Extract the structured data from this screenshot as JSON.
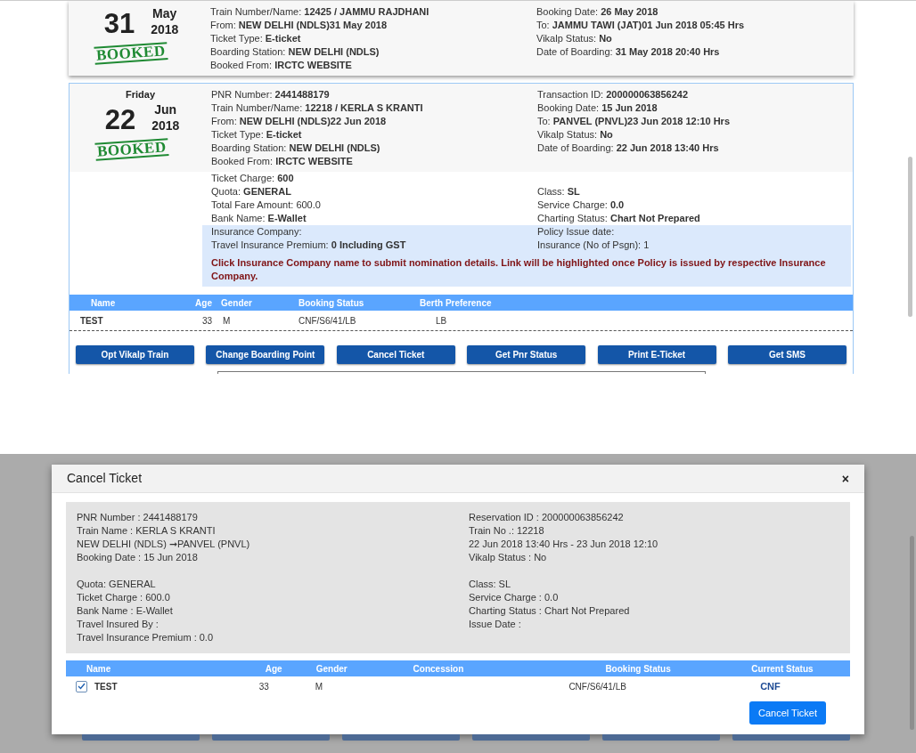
{
  "bookings": [
    {
      "selected": false,
      "day": "31",
      "month": "May",
      "year": "2018",
      "stamp": "BOOKED",
      "left": [
        "Train Number/Name: **12425 / JAMMU RAJDHANI**",
        "From: **NEW DELHI (NDLS)31 May 2018**",
        "Ticket Type: **E-ticket**",
        "Boarding Station: **NEW DELHI (NDLS)**",
        "Booked From: **IRCTC WEBSITE**"
      ],
      "right": [
        "Booking Date: **26 May 2018**",
        "To: **JAMMU TAWI (JAT)01 Jun 2018 05:45 Hrs**",
        "Vikalp Status: **No**",
        "Date of Boarding: **31 May 2018 20:40 Hrs**"
      ]
    },
    {
      "selected": true,
      "weekday": "Friday",
      "day": "22",
      "month": "Jun",
      "year": "2018",
      "stamp": "BOOKED",
      "left": [
        "PNR Number: **2441488179**",
        "Train Number/Name: **12218 / KERLA S KRANTI**",
        "From: **NEW DELHI (NDLS)22 Jun 2018**",
        "Ticket Type: **E-ticket**",
        "Boarding Station: **NEW DELHI (NDLS)**",
        "Booked From: **IRCTC WEBSITE**"
      ],
      "right": [
        "Transaction ID: **200000063856242**",
        "Booking Date: **15 Jun 2018**",
        "To: **PANVEL (PNVL)23 Jun 2018 12:10 Hrs**",
        "Vikalp Status: **No**",
        "Date of Boarding: **22 Jun 2018 13:40 Hrs**"
      ],
      "details": [
        {
          "left": "Ticket Charge: **600**"
        },
        {
          "left": "Quota: **GENERAL**",
          "right": "Class: **SL**"
        },
        {
          "left": "Total Fare Amount: 600.0",
          "right": "Service Charge: **0.0**"
        },
        {
          "left": "Bank Name: **E-Wallet**",
          "right": "Charting Status: **Chart Not Prepared**"
        }
      ],
      "insurance": [
        {
          "left": "Insurance Company:",
          "right": "Policy Issue date:"
        },
        {
          "left": "Travel Insurance Premium: **0 Including GST**",
          "right": "Insurance (No of Psgn): 1"
        }
      ],
      "notice": "Click Insurance Company name to submit nomination details. Link will be highlighted once Policy is issued by respective Insurance Company.",
      "passengers": {
        "columns": [
          "Name",
          "Age",
          "Gender",
          "Booking Status",
          "Berth Preference"
        ],
        "rows": [
          [
            "TEST",
            "33",
            "M",
            "CNF/S6/41/LB",
            "LB"
          ]
        ]
      },
      "actions": [
        "Opt Vikalp Train",
        "Change Boarding Point",
        "Cancel Ticket",
        "Get Pnr Status",
        "Print E-Ticket",
        "Get SMS"
      ]
    }
  ],
  "dialog": {
    "title": "Cancel Ticket",
    "close": "×",
    "info_left": [
      [
        "PNR Number : 2441488179",
        "Train Name : KERLA S KRANTI",
        "NEW DELHI (NDLS) ➞PANVEL (PNVL)",
        "Booking Date : 15 Jun 2018"
      ],
      [
        "Quota: GENERAL",
        "Ticket Charge : 600.0",
        "Bank Name : E-Wallet",
        "Travel Insured By :",
        "Travel Insurance Premium : 0.0"
      ]
    ],
    "info_right": [
      [
        "Reservation ID : 200000063856242",
        "Train No .: 12218",
        "22 Jun 2018 13:40 Hrs - 23 Jun 2018 12:10",
        "Vikalp Status : No"
      ],
      [
        "Class: SL",
        "Service Charge : 0.0",
        "Charting Status : Chart Not Prepared",
        "Issue Date :"
      ]
    ],
    "columns": [
      "Name",
      "Age",
      "Gender",
      "Concession",
      "Booking Status",
      "Current Status"
    ],
    "passengers": [
      {
        "checked": true,
        "name": "TEST",
        "age": "33",
        "gender": "M",
        "booking_status": "CNF/S6/41/LB",
        "current_status": "CNF"
      }
    ],
    "submit": "Cancel Ticket"
  }
}
